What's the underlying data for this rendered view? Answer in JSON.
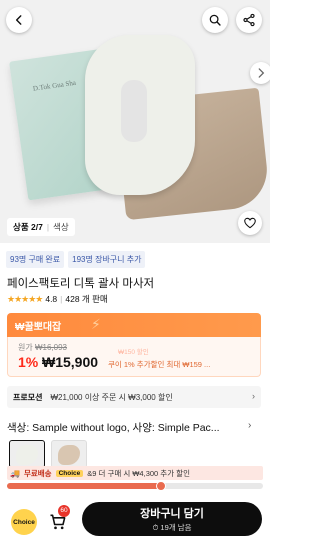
{
  "hero": {
    "box_label": "D.Tok Gua Sha",
    "counter_current": "상품 2/7",
    "counter_category": "색상"
  },
  "tags": [
    "93명 구매 완료",
    "193명 장바구니 추가"
  ],
  "product": {
    "title": "페이스팩토리 디톡 괄사 마사저",
    "stars": "★★★★★",
    "rating": "4.8",
    "sales": "428 개 판매"
  },
  "promo": {
    "label": "₩꿀뽀대잡"
  },
  "price": {
    "original_label": "원가",
    "original_value": "₩16,093",
    "discount": "1%",
    "sale": "₩15,900",
    "coupon_faded": "₩150 할인",
    "coupon": "쿠이 1% 추가할인 최대 ₩159 ..."
  },
  "shipping": {
    "label": "프로모션",
    "text": "₩21,000 이상 주문 시 ₩3,000 할인"
  },
  "options": {
    "label": "색상: Sample without logo, 사양: Simple Pac..."
  },
  "free_ship": {
    "label": "무료배송",
    "choice": "Choice",
    "text": "&9 더 구매 시 ₩4,300 추가 할인",
    "progress": 0.6
  },
  "bottom": {
    "choice_logo": "Choice",
    "cart_count": "60",
    "add_label": "장바구니 담기",
    "add_sub": "⏱ 19개 남음"
  },
  "colors": {
    "accent": "#ff8a3d",
    "price_red": "#ff2a1a",
    "cta": "#0d0d0d"
  }
}
